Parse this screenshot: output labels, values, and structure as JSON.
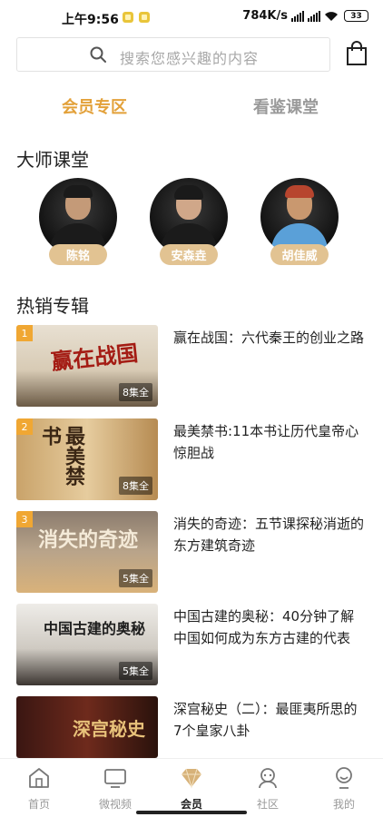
{
  "status": {
    "time": "上午9:56",
    "net_speed": "784K/s",
    "battery": "33"
  },
  "search": {
    "placeholder": "搜索您感兴趣的内容"
  },
  "tabs": [
    {
      "label": "会员专区",
      "active": true
    },
    {
      "label": "看鉴课堂",
      "active": false
    }
  ],
  "masters": {
    "title": "大师课堂",
    "items": [
      {
        "name": "陈铭"
      },
      {
        "name": "安森垚"
      },
      {
        "name": "胡佳威"
      }
    ]
  },
  "hot": {
    "title": "热销专辑",
    "items": [
      {
        "rank": "1",
        "title": "赢在战国：六代秦王的创业之路",
        "episodes": "8集全",
        "thumb_text": "赢在战国"
      },
      {
        "rank": "2",
        "title": "最美禁书:11本书让历代皇帝心惊胆战",
        "episodes": "8集全",
        "thumb_text": "最美禁书"
      },
      {
        "rank": "3",
        "title": "消失的奇迹：五节课探秘消逝的东方建筑奇迹",
        "episodes": "5集全",
        "thumb_text": "消失的奇迹"
      },
      {
        "rank": "",
        "title": "中国古建的奥秘：40分钟了解中国如何成为东方古建的代表",
        "episodes": "5集全",
        "thumb_text": "中国古建的奥秘"
      },
      {
        "rank": "",
        "title": "深宫秘史（二）：最匪夷所思的7个皇家八卦",
        "episodes": "",
        "thumb_text": "深宫秘史"
      }
    ]
  },
  "nav": [
    {
      "label": "首页",
      "icon": "home-icon",
      "active": false
    },
    {
      "label": "微视频",
      "icon": "tv-icon",
      "active": false
    },
    {
      "label": "会员",
      "icon": "diamond-icon",
      "active": true
    },
    {
      "label": "社区",
      "icon": "community-icon",
      "active": false
    },
    {
      "label": "我的",
      "icon": "profile-icon",
      "active": false
    }
  ],
  "colors": {
    "accent": "#e3a13a",
    "badge": "#f0a733",
    "name_pill": "#e2c392"
  }
}
